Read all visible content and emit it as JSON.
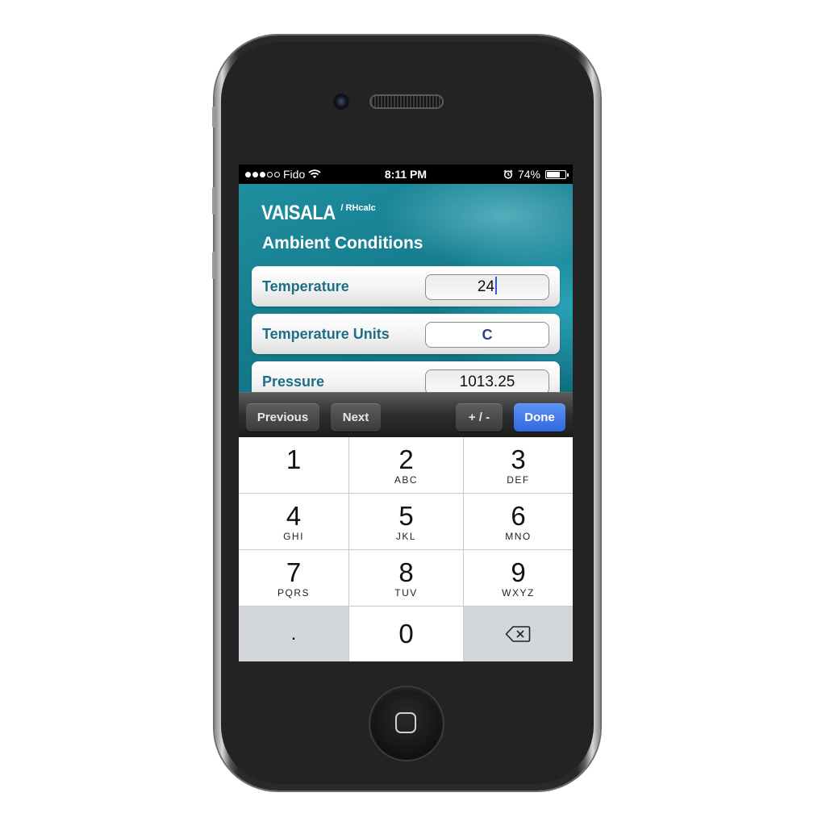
{
  "status_bar": {
    "carrier": "Fido",
    "time": "8:11 PM",
    "battery": "74%",
    "battery_level": 0.74,
    "signal_bars": 3
  },
  "app": {
    "brand": "VAISALA",
    "product": "/ RHcalc",
    "section_title": "Ambient Conditions",
    "rows": [
      {
        "label": "Temperature",
        "value": "24"
      },
      {
        "label": "Temperature Units",
        "value": "C"
      },
      {
        "label": "Pressure",
        "value": "1013.25"
      }
    ]
  },
  "toolbar": {
    "previous": "Previous",
    "next": "Next",
    "plus_minus": "+ / -",
    "done": "Done"
  },
  "keypad": {
    "keys": [
      {
        "digit": "1",
        "letters": ""
      },
      {
        "digit": "2",
        "letters": "ABC"
      },
      {
        "digit": "3",
        "letters": "DEF"
      },
      {
        "digit": "4",
        "letters": "GHI"
      },
      {
        "digit": "5",
        "letters": "JKL"
      },
      {
        "digit": "6",
        "letters": "MNO"
      },
      {
        "digit": "7",
        "letters": "PQRS"
      },
      {
        "digit": "8",
        "letters": "TUV"
      },
      {
        "digit": "9",
        "letters": "WXYZ"
      }
    ],
    "decimal": ".",
    "zero": "0"
  },
  "colors": {
    "accent_teal": "#167d8e",
    "label_blue": "#1e6f86",
    "done_blue": "#2f68e0"
  }
}
